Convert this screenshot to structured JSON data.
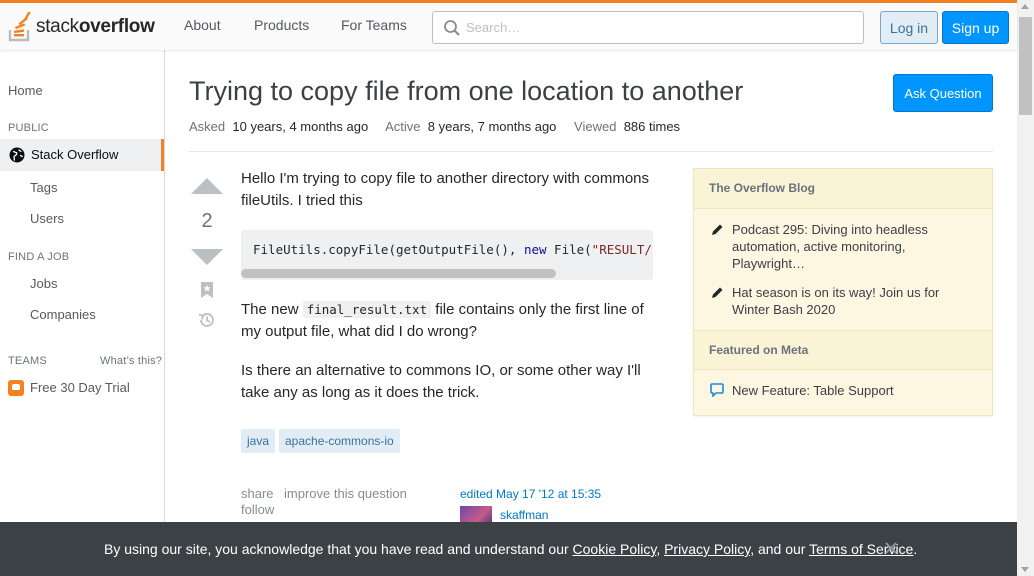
{
  "header": {
    "logo_word_1": "stack",
    "logo_word_2": "overflow",
    "nav": [
      "About",
      "Products",
      "For Teams"
    ],
    "search_placeholder": "Search…",
    "login_label": "Log in",
    "signup_label": "Sign up"
  },
  "sidebar": {
    "home": "Home",
    "public_heading": "PUBLIC",
    "stack_overflow": "Stack Overflow",
    "tags": "Tags",
    "users": "Users",
    "find_job_heading": "FIND A JOB",
    "jobs": "Jobs",
    "companies": "Companies",
    "teams_heading": "TEAMS",
    "whats_this": "What’s this?",
    "free_trial": "Free 30 Day Trial"
  },
  "question": {
    "title": "Trying to copy file from one location to another",
    "ask_button": "Ask Question",
    "asked_label": "Asked",
    "asked_value": "10 years, 4 months ago",
    "active_label": "Active",
    "active_value": "8 years, 7 months ago",
    "viewed_label": "Viewed",
    "viewed_value": "886 times",
    "votes": "2",
    "body_p1": "Hello I'm trying to copy file to another directory with commons fileUtils. I tried this",
    "code_part1": "FileUtils.copyFile(getOutputFile(), ",
    "code_keyword": "new",
    "code_part2": " File(",
    "code_string": "\"RESULT/fin",
    "body_p2_before": "The new ",
    "body_p2_code": "final_result.txt",
    "body_p2_after": " file contains only the first line of my output file, what did I do wrong?",
    "body_p3": "Is there an alternative to commons IO, or some other way I'll take any as long as it does the trick.",
    "tags": [
      "java",
      "apache-commons-io"
    ],
    "share": "share",
    "improve": "improve this question",
    "follow": "follow",
    "edited": "edited May 17 '12 at 15:35",
    "editor": "skaffman"
  },
  "widget": {
    "blog_heading": "The Overflow Blog",
    "blog_items": [
      "Podcast 295: Diving into headless automation, active monitoring, Playwright…",
      "Hat season is on its way! Join us for Winter Bash 2020"
    ],
    "meta_heading": "Featured on Meta",
    "meta_items": [
      "New Feature: Table Support"
    ]
  },
  "cookie": {
    "prefix": "By using our site, you acknowledge that you have read and understand our ",
    "cookie_policy": "Cookie Policy",
    "comma": ", ",
    "privacy_policy": "Privacy Policy",
    "and_our": ", and our ",
    "terms": "Terms of Service",
    "period": "."
  },
  "colors": {
    "accent": "#f48024",
    "primary_button": "#0095ff",
    "link": "#0077cc",
    "tag_bg": "#e1ecf4",
    "widget_bg": "#fbf3d5",
    "banner_bg": "#3c4146"
  }
}
